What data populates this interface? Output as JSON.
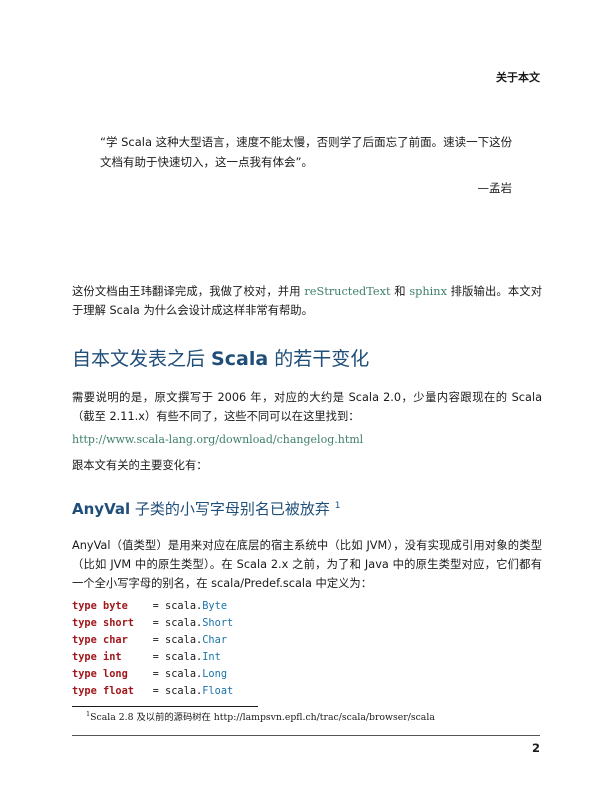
{
  "header": {
    "title": "关于本文"
  },
  "quote": {
    "text": "“学 Scala 这种大型语言，速度不能太慢，否则学了后面忘了前面。速读一下这份文档有助于快速切入，这一点我有体会”。",
    "attribution": "—孟岩"
  },
  "intro": {
    "before_link1": "这份文档由王玮翻译完成，我做了校对，并用 ",
    "link1": "reStructedText",
    "between_links": " 和 ",
    "link2": "sphinx",
    "after_links": " 排版输出。本文对于理解 Scala 为什么会设计成这样非常有帮助。"
  },
  "section1": {
    "title_prefix": "自本文发表之后 ",
    "title_bold": "Scala",
    "title_suffix": " 的若干变化",
    "para1": "需要说明的是，原文撰写于 2006 年，对应的大约是 Scala 2.0，少量内容跟现在的 Scala（截至 2.11.x）有些不同了，这些不同可以在这里找到：",
    "changelog_link": "http://www.scala-lang.org/download/changelog.html",
    "para2": "跟本文有关的主要变化有："
  },
  "section2": {
    "title_bold": "AnyVal",
    "title_rest": " 子类的小写字母别名已被放弃",
    "footnote_ref": "1",
    "para": "AnyVal（值类型）是用来对应在底层的宿主系统中（比如 JVM），没有实现成引用对象的类型（比如 JVM 中的原生类型）。在 Scala 2.x 之前，为了和 Java 中的原生类型对应，它们都有一个全小写字母的别名，在 scala/Predef.scala 中定义为："
  },
  "code": [
    {
      "kw": "type",
      "name": "byte",
      "eq": "=",
      "pkg": "scala.",
      "cls": "Byte"
    },
    {
      "kw": "type",
      "name": "short",
      "eq": "=",
      "pkg": "scala.",
      "cls": "Short"
    },
    {
      "kw": "type",
      "name": "char",
      "eq": "=",
      "pkg": "scala.",
      "cls": "Char"
    },
    {
      "kw": "type",
      "name": "int",
      "eq": "=",
      "pkg": "scala.",
      "cls": "Int"
    },
    {
      "kw": "type",
      "name": "long",
      "eq": "=",
      "pkg": "scala.",
      "cls": "Long"
    },
    {
      "kw": "type",
      "name": "float",
      "eq": "=",
      "pkg": "scala.",
      "cls": "Float"
    }
  ],
  "footnote": {
    "mark": "1",
    "text": "Scala 2.8 及以前的源码树在 http://lampsvn.epfl.ch/trac/scala/browser/scala"
  },
  "page_number": "2"
}
